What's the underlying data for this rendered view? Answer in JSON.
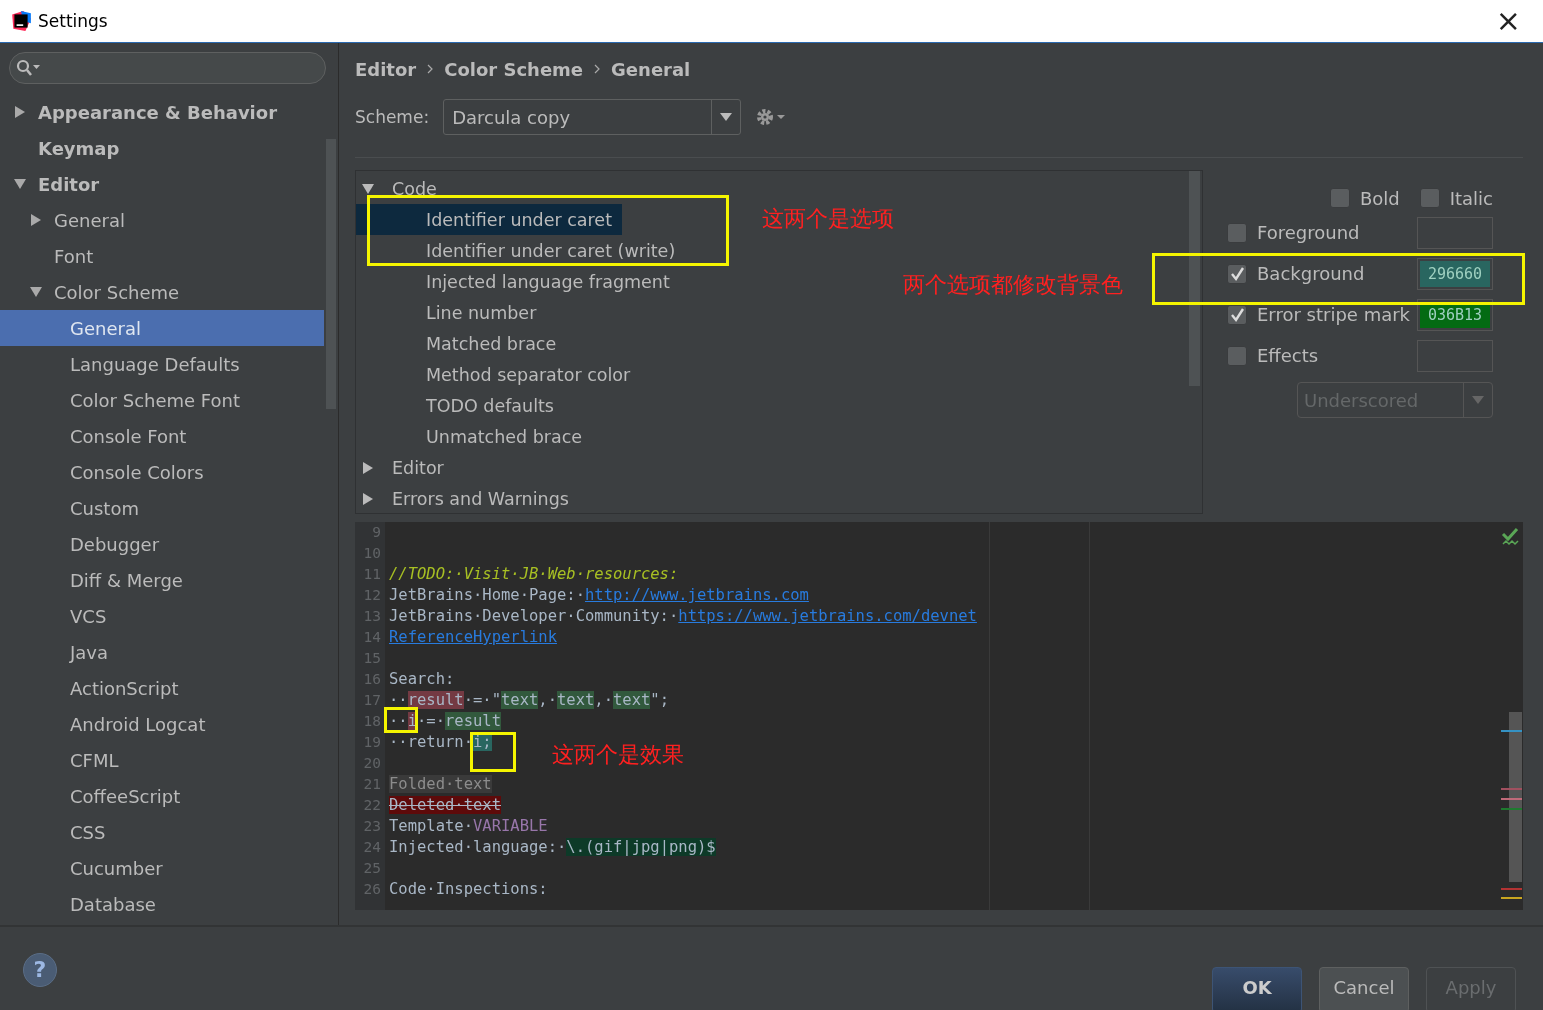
{
  "window": {
    "title": "Settings",
    "close": "×"
  },
  "sidebar": {
    "items": [
      {
        "label": "Appearance & Behavior",
        "expanded": false,
        "selected": false
      },
      {
        "label": "Keymap",
        "selected": false
      },
      {
        "label": "Editor",
        "expanded": true,
        "selected": false,
        "children": [
          {
            "label": "General",
            "expanded": false,
            "selected": false
          },
          {
            "label": "Font",
            "selected": false
          },
          {
            "label": "Color Scheme",
            "expanded": true,
            "selected": false,
            "children": [
              {
                "label": "General",
                "selected": true
              },
              {
                "label": "Language Defaults",
                "selected": false
              },
              {
                "label": "Color Scheme Font",
                "selected": false
              },
              {
                "label": "Console Font",
                "selected": false
              },
              {
                "label": "Console Colors",
                "selected": false
              },
              {
                "label": "Custom",
                "selected": false
              },
              {
                "label": "Debugger",
                "selected": false
              },
              {
                "label": "Diff & Merge",
                "selected": false
              },
              {
                "label": "VCS",
                "selected": false
              },
              {
                "label": "Java",
                "selected": false
              },
              {
                "label": "ActionScript",
                "selected": false
              },
              {
                "label": "Android Logcat",
                "selected": false
              },
              {
                "label": "CFML",
                "selected": false
              },
              {
                "label": "CoffeeScript",
                "selected": false
              },
              {
                "label": "CSS",
                "selected": false
              },
              {
                "label": "Cucumber",
                "selected": false
              },
              {
                "label": "Database",
                "selected": false
              }
            ]
          }
        ]
      }
    ]
  },
  "breadcrumb": [
    "Editor",
    "Color Scheme",
    "General"
  ],
  "scheme": {
    "label": "Scheme:",
    "value": "Darcula copy"
  },
  "elements": [
    {
      "label": "Code",
      "expanded": true,
      "selected": false,
      "children": [
        {
          "label": "Identifier under caret",
          "selected": true
        },
        {
          "label": "Identifier under caret (write)",
          "selected": false
        },
        {
          "label": "Injected language fragment",
          "selected": false
        },
        {
          "label": "Line number",
          "selected": false
        },
        {
          "label": "Matched brace",
          "selected": false
        },
        {
          "label": "Method separator color",
          "selected": false
        },
        {
          "label": "TODO defaults",
          "selected": false
        },
        {
          "label": "Unmatched brace",
          "selected": false
        }
      ]
    },
    {
      "label": "Editor",
      "expanded": false,
      "selected": false
    },
    {
      "label": "Errors and Warnings",
      "expanded": false,
      "selected": false
    }
  ],
  "font_style": [
    {
      "label": "Bold",
      "checked": false
    },
    {
      "label": "Italic",
      "checked": false
    }
  ],
  "attributes": [
    {
      "label": "Foreground",
      "checked": false
    },
    {
      "label": "Background",
      "checked": true,
      "value": "296660",
      "color": "#296660"
    },
    {
      "label": "Error stripe mark",
      "checked": true,
      "value": "036B13",
      "color": "#036b13"
    },
    {
      "label": "Effects",
      "checked": false
    }
  ],
  "effect_type": {
    "value": "Underscored",
    "disabled": true
  },
  "preview": [
    {
      "num": "9"
    },
    {
      "num": "10"
    },
    {
      "num": "11",
      "segments": [
        {
          "text": "//TODO:·Visit·JB·Web·resources:",
          "kind": "todo"
        }
      ]
    },
    {
      "num": "12",
      "segments": [
        {
          "text": "JetBrains·Home·Page:·",
          "kind": "plain"
        },
        {
          "text": "http://www.jetbrains.com",
          "kind": "link"
        }
      ]
    },
    {
      "num": "13",
      "segments": [
        {
          "text": "JetBrains·Developer·Community:·",
          "kind": "plain"
        },
        {
          "text": "https://www.jetbrains.com/devnet",
          "kind": "link"
        }
      ]
    },
    {
      "num": "14",
      "segments": [
        {
          "text": "ReferenceHyperlink",
          "kind": "link"
        }
      ]
    },
    {
      "num": "15"
    },
    {
      "num": "16",
      "segments": [
        {
          "text": "Search:",
          "kind": "plain"
        }
      ]
    },
    {
      "num": "17",
      "segments": [
        {
          "text": "··",
          "kind": "plain"
        },
        {
          "text": "result",
          "kind": "write"
        },
        {
          "text": "·=·\"",
          "kind": "plain"
        },
        {
          "text": "text",
          "kind": "match"
        },
        {
          "text": ",·",
          "kind": "plain"
        },
        {
          "text": "text",
          "kind": "match"
        },
        {
          "text": ",·",
          "kind": "plain"
        },
        {
          "text": "text",
          "kind": "match"
        },
        {
          "text": "\";",
          "kind": "plain"
        }
      ]
    },
    {
      "num": "18",
      "segments": [
        {
          "text": "··",
          "kind": "plain"
        },
        {
          "text": "i",
          "kind": "write"
        },
        {
          "text": "·=·",
          "kind": "plain"
        },
        {
          "text": "result",
          "kind": "match"
        }
      ]
    },
    {
      "num": "19",
      "segments": [
        {
          "text": "··return·",
          "kind": "plain"
        },
        {
          "text": "i;",
          "kind": "caret"
        }
      ]
    },
    {
      "num": "20"
    },
    {
      "num": "21",
      "segments": [
        {
          "text": "Folded·text",
          "kind": "folded"
        }
      ]
    },
    {
      "num": "22",
      "segments": [
        {
          "text": "Deleted·text",
          "kind": "deleted"
        }
      ]
    },
    {
      "num": "23",
      "segments": [
        {
          "text": "Template·",
          "kind": "plain"
        },
        {
          "text": "VARIABLE",
          "kind": "variable"
        }
      ]
    },
    {
      "num": "24",
      "segments": [
        {
          "text": "Injected·language:·",
          "kind": "plain"
        },
        {
          "text": "\\.(gif|jpg|png)$",
          "kind": "injected"
        }
      ]
    },
    {
      "num": "25"
    },
    {
      "num": "26",
      "segments": [
        {
          "text": "Code·Inspections:",
          "kind": "plain"
        }
      ]
    }
  ],
  "annotations": [
    {
      "kind": "box"
    },
    {
      "kind": "note",
      "text": "这两个是选项"
    },
    {
      "kind": "note",
      "text": "两个选项都修改背景色"
    },
    {
      "kind": "box"
    },
    {
      "kind": "box"
    },
    {
      "kind": "box"
    },
    {
      "kind": "note",
      "text": "这两个是效果"
    }
  ],
  "help": "?",
  "buttons": [
    {
      "label": "OK",
      "kind": "default"
    },
    {
      "label": "Cancel",
      "kind": "normal"
    },
    {
      "label": "Apply",
      "kind": "disabled"
    }
  ]
}
